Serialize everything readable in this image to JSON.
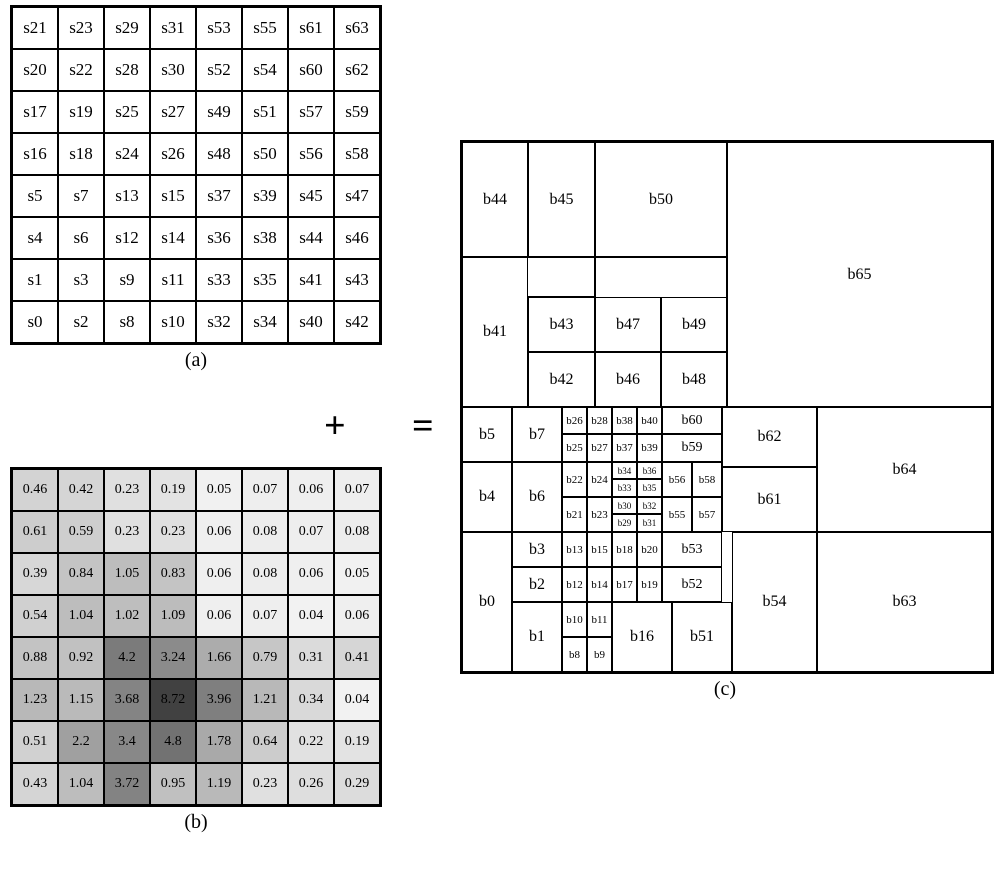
{
  "panel_a": {
    "label": "(a)",
    "rows": [
      [
        "s21",
        "s23",
        "s29",
        "s31",
        "s53",
        "s55",
        "s61",
        "s63"
      ],
      [
        "s20",
        "s22",
        "s28",
        "s30",
        "s52",
        "s54",
        "s60",
        "s62"
      ],
      [
        "s17",
        "s19",
        "s25",
        "s27",
        "s49",
        "s51",
        "s57",
        "s59"
      ],
      [
        "s16",
        "s18",
        "s24",
        "s26",
        "s48",
        "s50",
        "s56",
        "s58"
      ],
      [
        "s5",
        "s7",
        "s13",
        "s15",
        "s37",
        "s39",
        "s45",
        "s47"
      ],
      [
        "s4",
        "s6",
        "s12",
        "s14",
        "s36",
        "s38",
        "s44",
        "s46"
      ],
      [
        "s1",
        "s3",
        "s9",
        "s11",
        "s33",
        "s35",
        "s41",
        "s43"
      ],
      [
        "s0",
        "s2",
        "s8",
        "s10",
        "s32",
        "s34",
        "s40",
        "s42"
      ]
    ]
  },
  "panel_b": {
    "label": "(b)",
    "rows": [
      [
        0.46,
        0.42,
        0.23,
        0.19,
        0.05,
        0.07,
        0.06,
        0.07
      ],
      [
        0.61,
        0.59,
        0.23,
        0.23,
        0.06,
        0.08,
        0.07,
        0.08
      ],
      [
        0.39,
        0.84,
        1.05,
        0.83,
        0.06,
        0.08,
        0.06,
        0.05
      ],
      [
        0.54,
        1.04,
        1.02,
        1.09,
        0.06,
        0.07,
        0.04,
        0.06
      ],
      [
        0.88,
        0.92,
        4.2,
        3.24,
        1.66,
        0.79,
        0.31,
        0.41
      ],
      [
        1.23,
        1.15,
        3.68,
        8.72,
        3.96,
        1.21,
        0.34,
        0.04
      ],
      [
        0.51,
        2.2,
        3.4,
        4.8,
        1.78,
        0.64,
        0.22,
        0.19
      ],
      [
        0.43,
        1.04,
        3.72,
        0.95,
        1.19,
        0.23,
        0.26,
        0.29
      ]
    ]
  },
  "operators": {
    "plus": "+",
    "equals": "="
  },
  "panel_c": {
    "label": "(c)",
    "labels": {
      "b0": "b0",
      "b1": "b1",
      "b2": "b2",
      "b3": "b3",
      "b4": "b4",
      "b5": "b5",
      "b6": "b6",
      "b7": "b7",
      "b8": "b8",
      "b9": "b9",
      "b10": "b10",
      "b11": "b11",
      "b12": "b12",
      "b13": "b13",
      "b14": "b14",
      "b15": "b15",
      "b16": "b16",
      "b17": "b17",
      "b18": "b18",
      "b19": "b19",
      "b20": "b20",
      "b21": "b21",
      "b22": "b22",
      "b23": "b23",
      "b24": "b24",
      "b25": "b25",
      "b26": "b26",
      "b27": "b27",
      "b28": "b28",
      "b29": "b29",
      "b30": "b30",
      "b31": "b31",
      "b32": "b32",
      "b33": "b33",
      "b34": "b34",
      "b35": "b35",
      "b36": "b36",
      "b37": "b37",
      "b38": "b38",
      "b39": "b39",
      "b40": "b40",
      "b41": "b41",
      "b42": "b42",
      "b43": "b43",
      "b44": "b44",
      "b45": "b45",
      "b46": "b46",
      "b47": "b47",
      "b48": "b48",
      "b49": "b49",
      "b50": "b50",
      "b51": "b51",
      "b52": "b52",
      "b53": "b53",
      "b54": "b54",
      "b55": "b55",
      "b56": "b56",
      "b57": "b57",
      "b58": "b58",
      "b59": "b59",
      "b60": "b60",
      "b61": "b61",
      "b62": "b62",
      "b63": "b63",
      "b64": "b64",
      "b65": "b65"
    }
  },
  "chart_data": {
    "type": "heatmap",
    "title": "Panel (b) value grid — low values white, high values dark",
    "xlabel": "",
    "ylabel": "",
    "grid_8x8_row_major_top_to_bottom": [
      [
        0.46,
        0.42,
        0.23,
        0.19,
        0.05,
        0.07,
        0.06,
        0.07
      ],
      [
        0.61,
        0.59,
        0.23,
        0.23,
        0.06,
        0.08,
        0.07,
        0.08
      ],
      [
        0.39,
        0.84,
        1.05,
        0.83,
        0.06,
        0.08,
        0.06,
        0.05
      ],
      [
        0.54,
        1.04,
        1.02,
        1.09,
        0.06,
        0.07,
        0.04,
        0.06
      ],
      [
        0.88,
        0.92,
        4.2,
        3.24,
        1.66,
        0.79,
        0.31,
        0.41
      ],
      [
        1.23,
        1.15,
        3.68,
        8.72,
        3.96,
        1.21,
        0.34,
        0.04
      ],
      [
        0.51,
        2.2,
        3.4,
        4.8,
        1.78,
        0.64,
        0.22,
        0.19
      ],
      [
        0.43,
        1.04,
        3.72,
        0.95,
        1.19,
        0.23,
        0.26,
        0.29
      ]
    ],
    "value_range_observed": [
      0.04,
      8.72
    ]
  }
}
